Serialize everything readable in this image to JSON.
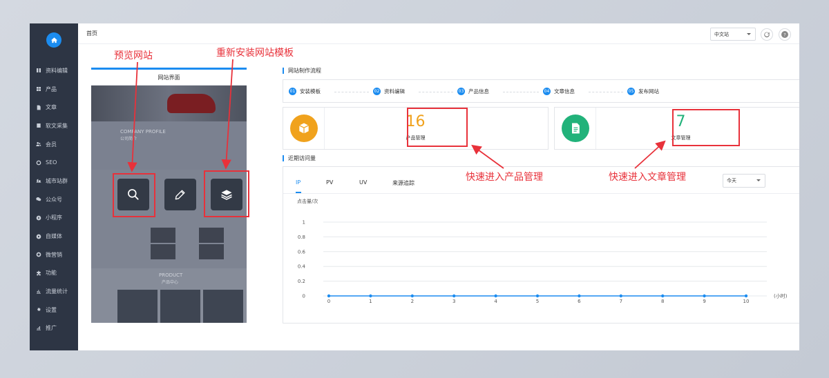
{
  "topbar": {
    "title": "首页",
    "lang": "中文站"
  },
  "sidebar": {
    "items": [
      {
        "label": "资料编辑",
        "icon": "book-icon"
      },
      {
        "label": "产品",
        "icon": "grid-icon"
      },
      {
        "label": "文章",
        "icon": "document-icon"
      },
      {
        "label": "软文采集",
        "icon": "collect-icon"
      },
      {
        "label": "会员",
        "icon": "users-icon"
      },
      {
        "label": "SEO",
        "icon": "seo-icon"
      },
      {
        "label": "城市站群",
        "icon": "city-icon"
      },
      {
        "label": "公众号",
        "icon": "wechat-icon"
      },
      {
        "label": "小程序",
        "icon": "miniapp-icon"
      },
      {
        "label": "自媒体",
        "icon": "media-icon"
      },
      {
        "label": "微营销",
        "icon": "marketing-icon"
      },
      {
        "label": "功能",
        "icon": "puzzle-icon"
      },
      {
        "label": "流量统计",
        "icon": "bar-chart-icon"
      },
      {
        "label": "设置",
        "icon": "gear-icon"
      },
      {
        "label": "推广",
        "icon": "promote-icon"
      }
    ]
  },
  "preview": {
    "tab_label": "网站界面",
    "profile_text": "COMPANY PROFILE",
    "profile_sub": "公司简介",
    "product_text": "PRODUCT",
    "product_sub": "产品中心"
  },
  "annotations": {
    "preview_site": "预览网站",
    "reinstall": "重新安装网站模板",
    "quick_product": "快速进入产品管理",
    "quick_article": "快速进入文章管理"
  },
  "process": {
    "title": "网站制作流程",
    "steps": [
      {
        "num": "01",
        "label": "安装模板"
      },
      {
        "num": "02",
        "label": "资料编辑"
      },
      {
        "num": "03",
        "label": "产品信息"
      },
      {
        "num": "04",
        "label": "文章信息"
      },
      {
        "num": "05",
        "label": "发布网站"
      }
    ]
  },
  "stats": {
    "product": {
      "count": "16",
      "label": "产品管理",
      "color": "#f0a21d"
    },
    "article": {
      "count": "7",
      "label": "文章管理",
      "color": "#21b27a"
    }
  },
  "visits": {
    "title": "近期访问量",
    "tabs": [
      "IP",
      "PV",
      "UV",
      "来源追踪"
    ],
    "range": "今天"
  },
  "colors": {
    "accent": "#1b8cf0",
    "annotation": "#e8313a",
    "sidebar": "#2d3544"
  },
  "chart_data": {
    "type": "line",
    "ylabel": "点击量/次",
    "xlabel": "(小时)",
    "x": [
      0,
      1,
      2,
      3,
      4,
      5,
      6,
      7,
      8,
      9,
      10
    ],
    "series": [
      {
        "values": [
          0,
          0,
          0,
          0,
          0,
          0,
          0,
          0,
          0,
          0,
          0
        ]
      }
    ],
    "y_ticks": [
      "0",
      "0.2",
      "0.4",
      "0.6",
      "0.8",
      "1"
    ],
    "ylim": [
      0,
      1
    ],
    "grid": true
  }
}
